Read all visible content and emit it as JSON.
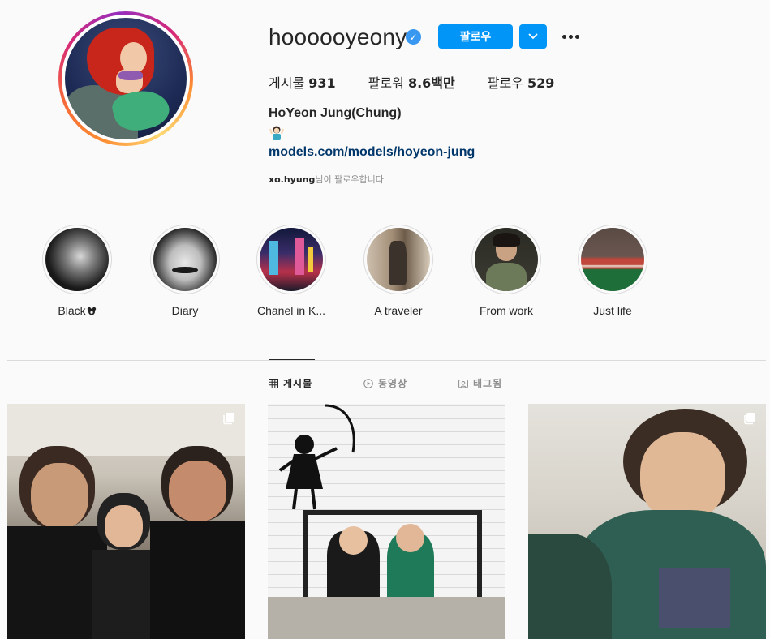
{
  "profile": {
    "username": "hoooooyeony",
    "verified_mark": "✓",
    "follow_label": "팔로우",
    "stats": {
      "posts_label": "게시물",
      "posts_value": "931",
      "followers_label": "팔로워",
      "followers_value": "8.6백만",
      "following_label": "팔로우",
      "following_value": "529"
    },
    "full_name": "HoYeon Jung(Chung)",
    "link": "models.com/models/hoyeon-jung",
    "followed_by_user": "xo.hyung",
    "followed_by_suffix": "님이 팔로우합니다"
  },
  "highlights": [
    {
      "label": "Black"
    },
    {
      "label": "Diary"
    },
    {
      "label": "Chanel in K..."
    },
    {
      "label": "A traveler"
    },
    {
      "label": "From work"
    },
    {
      "label": "Just life"
    }
  ],
  "tabs": [
    {
      "label": "게시물",
      "icon": "grid-icon",
      "active": true
    },
    {
      "label": "동영상",
      "icon": "play-icon",
      "active": false
    },
    {
      "label": "태그됨",
      "icon": "tag-icon",
      "active": false
    }
  ],
  "colors": {
    "accent": "#0095f6",
    "link": "#00376b",
    "verified": "#3897f0"
  }
}
